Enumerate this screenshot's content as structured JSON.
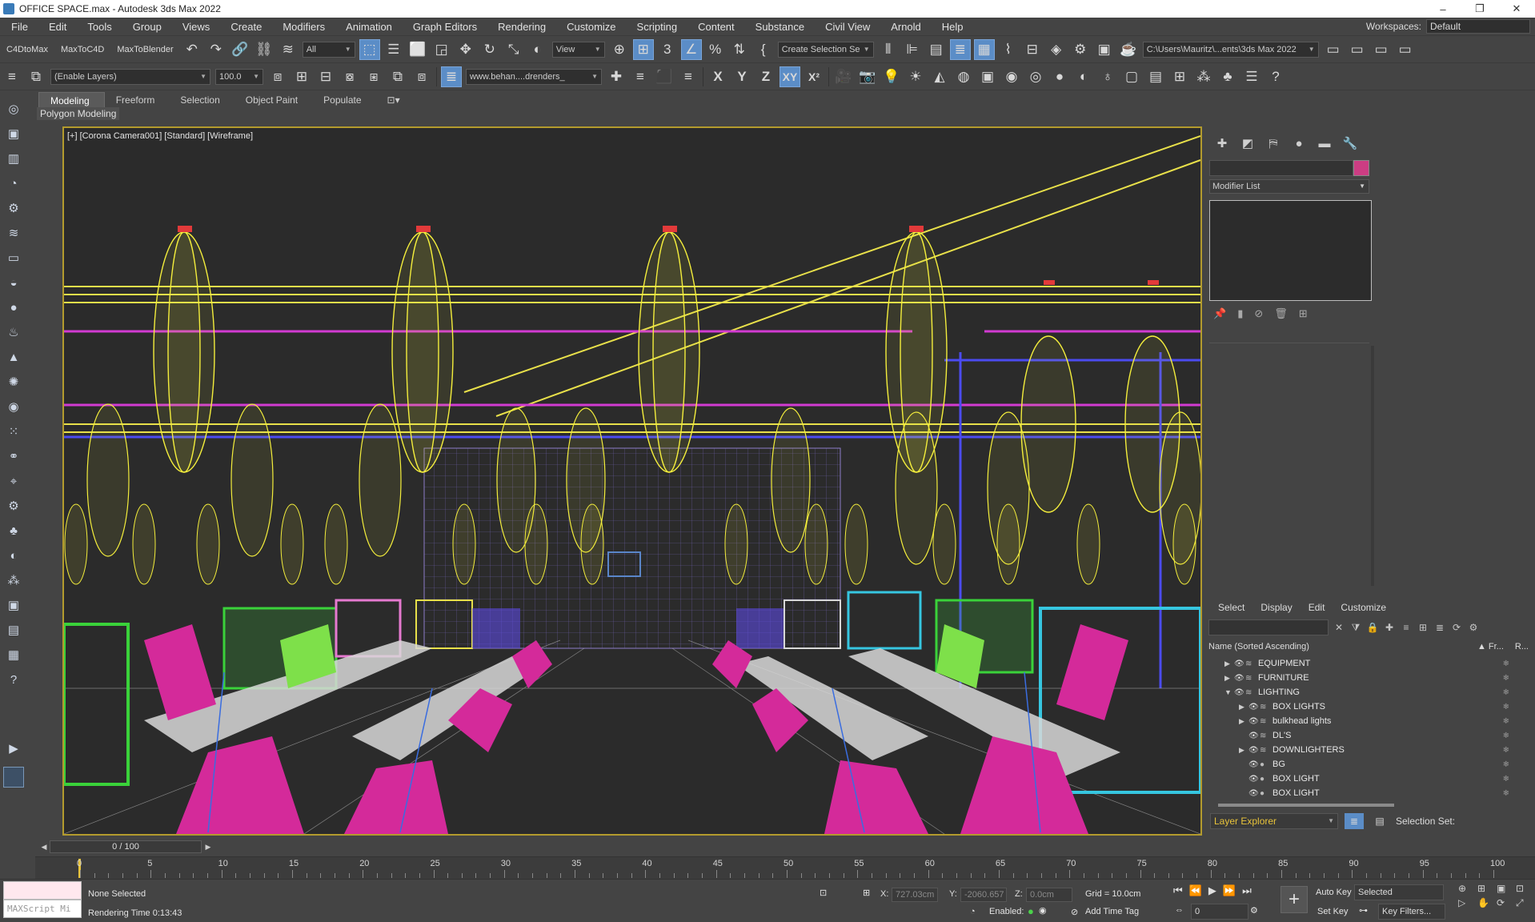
{
  "window": {
    "title": "OFFICE SPACE.max - Autodesk 3ds Max 2022",
    "controls": [
      "–",
      "❐",
      "✕"
    ]
  },
  "menu": {
    "items": [
      "File",
      "Edit",
      "Tools",
      "Group",
      "Views",
      "Create",
      "Modifiers",
      "Animation",
      "Graph Editors",
      "Rendering",
      "Customize",
      "Scripting",
      "Content",
      "Substance",
      "Civil View",
      "Arnold",
      "Help"
    ],
    "workspaces_label": "Workspaces:",
    "workspace_value": "Default"
  },
  "toolbar1": {
    "plugins": [
      "C4DtoMax",
      "MaxToC4D",
      "MaxToBlender"
    ],
    "filter_select": "All",
    "view_select": "View",
    "selection_set": "Create Selection Se",
    "project_path": "C:\\Users\\Mauritz\\...ents\\3ds Max 2022"
  },
  "toolbar2": {
    "layer_select": "(Enable Layers)",
    "opacity_value": "100.0",
    "render_preset": "www.behan....drenders_",
    "axes": [
      "X",
      "Y",
      "Z",
      "XY",
      "X²"
    ]
  },
  "ribbon": {
    "tabs": [
      "Modeling",
      "Freeform",
      "Selection",
      "Object Paint",
      "Populate"
    ],
    "subtab": "Polygon Modeling"
  },
  "viewport": {
    "label": "[+] [Corona Camera001] [Standard] [Wireframe]"
  },
  "command_panel": {
    "modifier_list": "Modifier List",
    "swatch_color": "#cc3d83"
  },
  "layer_explorer": {
    "menu": [
      "Select",
      "Display",
      "Edit",
      "Customize"
    ],
    "column_name": "Name (Sorted Ascending)",
    "column_fr": "▲ Fr...",
    "column_r": "R...",
    "rows": [
      {
        "name": "EQUIPMENT",
        "level": 0,
        "expander": "▶"
      },
      {
        "name": "FURNITURE",
        "level": 0,
        "expander": "▶"
      },
      {
        "name": "LIGHTING",
        "level": 0,
        "expander": "▼"
      },
      {
        "name": "BOX LIGHTS",
        "level": 1,
        "expander": "▶"
      },
      {
        "name": "bulkhead lights",
        "level": 1,
        "expander": "▶"
      },
      {
        "name": "DL'S",
        "level": 1,
        "expander": ""
      },
      {
        "name": "DOWNLIGHTERS",
        "level": 1,
        "expander": "▶"
      },
      {
        "name": "BG",
        "level": 1,
        "expander": ""
      },
      {
        "name": "BOX LIGHT",
        "level": 1,
        "expander": ""
      },
      {
        "name": "BOX LIGHT",
        "level": 1,
        "expander": ""
      }
    ],
    "explorer_select": "Layer Explorer",
    "selection_set_label": "Selection Set:"
  },
  "timeslider": {
    "value": "0 / 100"
  },
  "timeline": {
    "labels": [
      "0",
      "5",
      "10",
      "15",
      "20",
      "25",
      "30",
      "35",
      "40",
      "45",
      "50",
      "55",
      "60",
      "65",
      "70",
      "75",
      "80",
      "85",
      "90",
      "95",
      "100"
    ]
  },
  "status": {
    "maxscript_placeholder": "MAXScript Mi",
    "selection": "None Selected",
    "render_time": "Rendering Time  0:13:43",
    "x_label": "X:",
    "x_value": "727.03cm",
    "y_label": "Y:",
    "y_value": "-2060.657",
    "z_label": "Z:",
    "z_value": "0.0cm",
    "grid": "Grid = 10.0cm",
    "enabled_label": "Enabled:",
    "add_time_tag": "Add Time Tag",
    "auto_key": "Auto Key",
    "set_key": "Set Key",
    "selected": "Selected",
    "frame_value": "0",
    "key_filters": "Key Filters..."
  }
}
